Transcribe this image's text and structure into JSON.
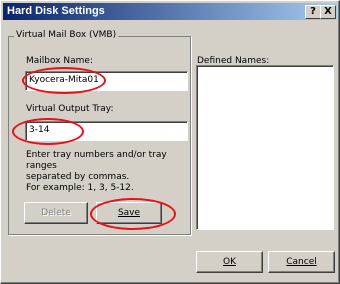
{
  "dialog": {
    "title": "Hard Disk Settings",
    "help_button": "?",
    "close_button": "X"
  },
  "group": {
    "legend": "Virtual Mail Box (VMB)",
    "mailbox_name_label": "Mailbox Name:",
    "mailbox_name_value": "Kyocera-Mita01",
    "output_tray_label": "Virtual Output Tray:",
    "output_tray_value": "3-14",
    "help_line1": "Enter tray numbers and/or tray ranges",
    "help_line2": "separated by commas.",
    "help_line3": "For example: 1, 3, 5-12.",
    "delete_label": "Delete",
    "save_label": "Save"
  },
  "defined_names": {
    "label": "Defined Names:",
    "items": []
  },
  "footer": {
    "ok_label": "OK",
    "cancel_label": "Cancel"
  },
  "highlight_color": "#e8101a"
}
